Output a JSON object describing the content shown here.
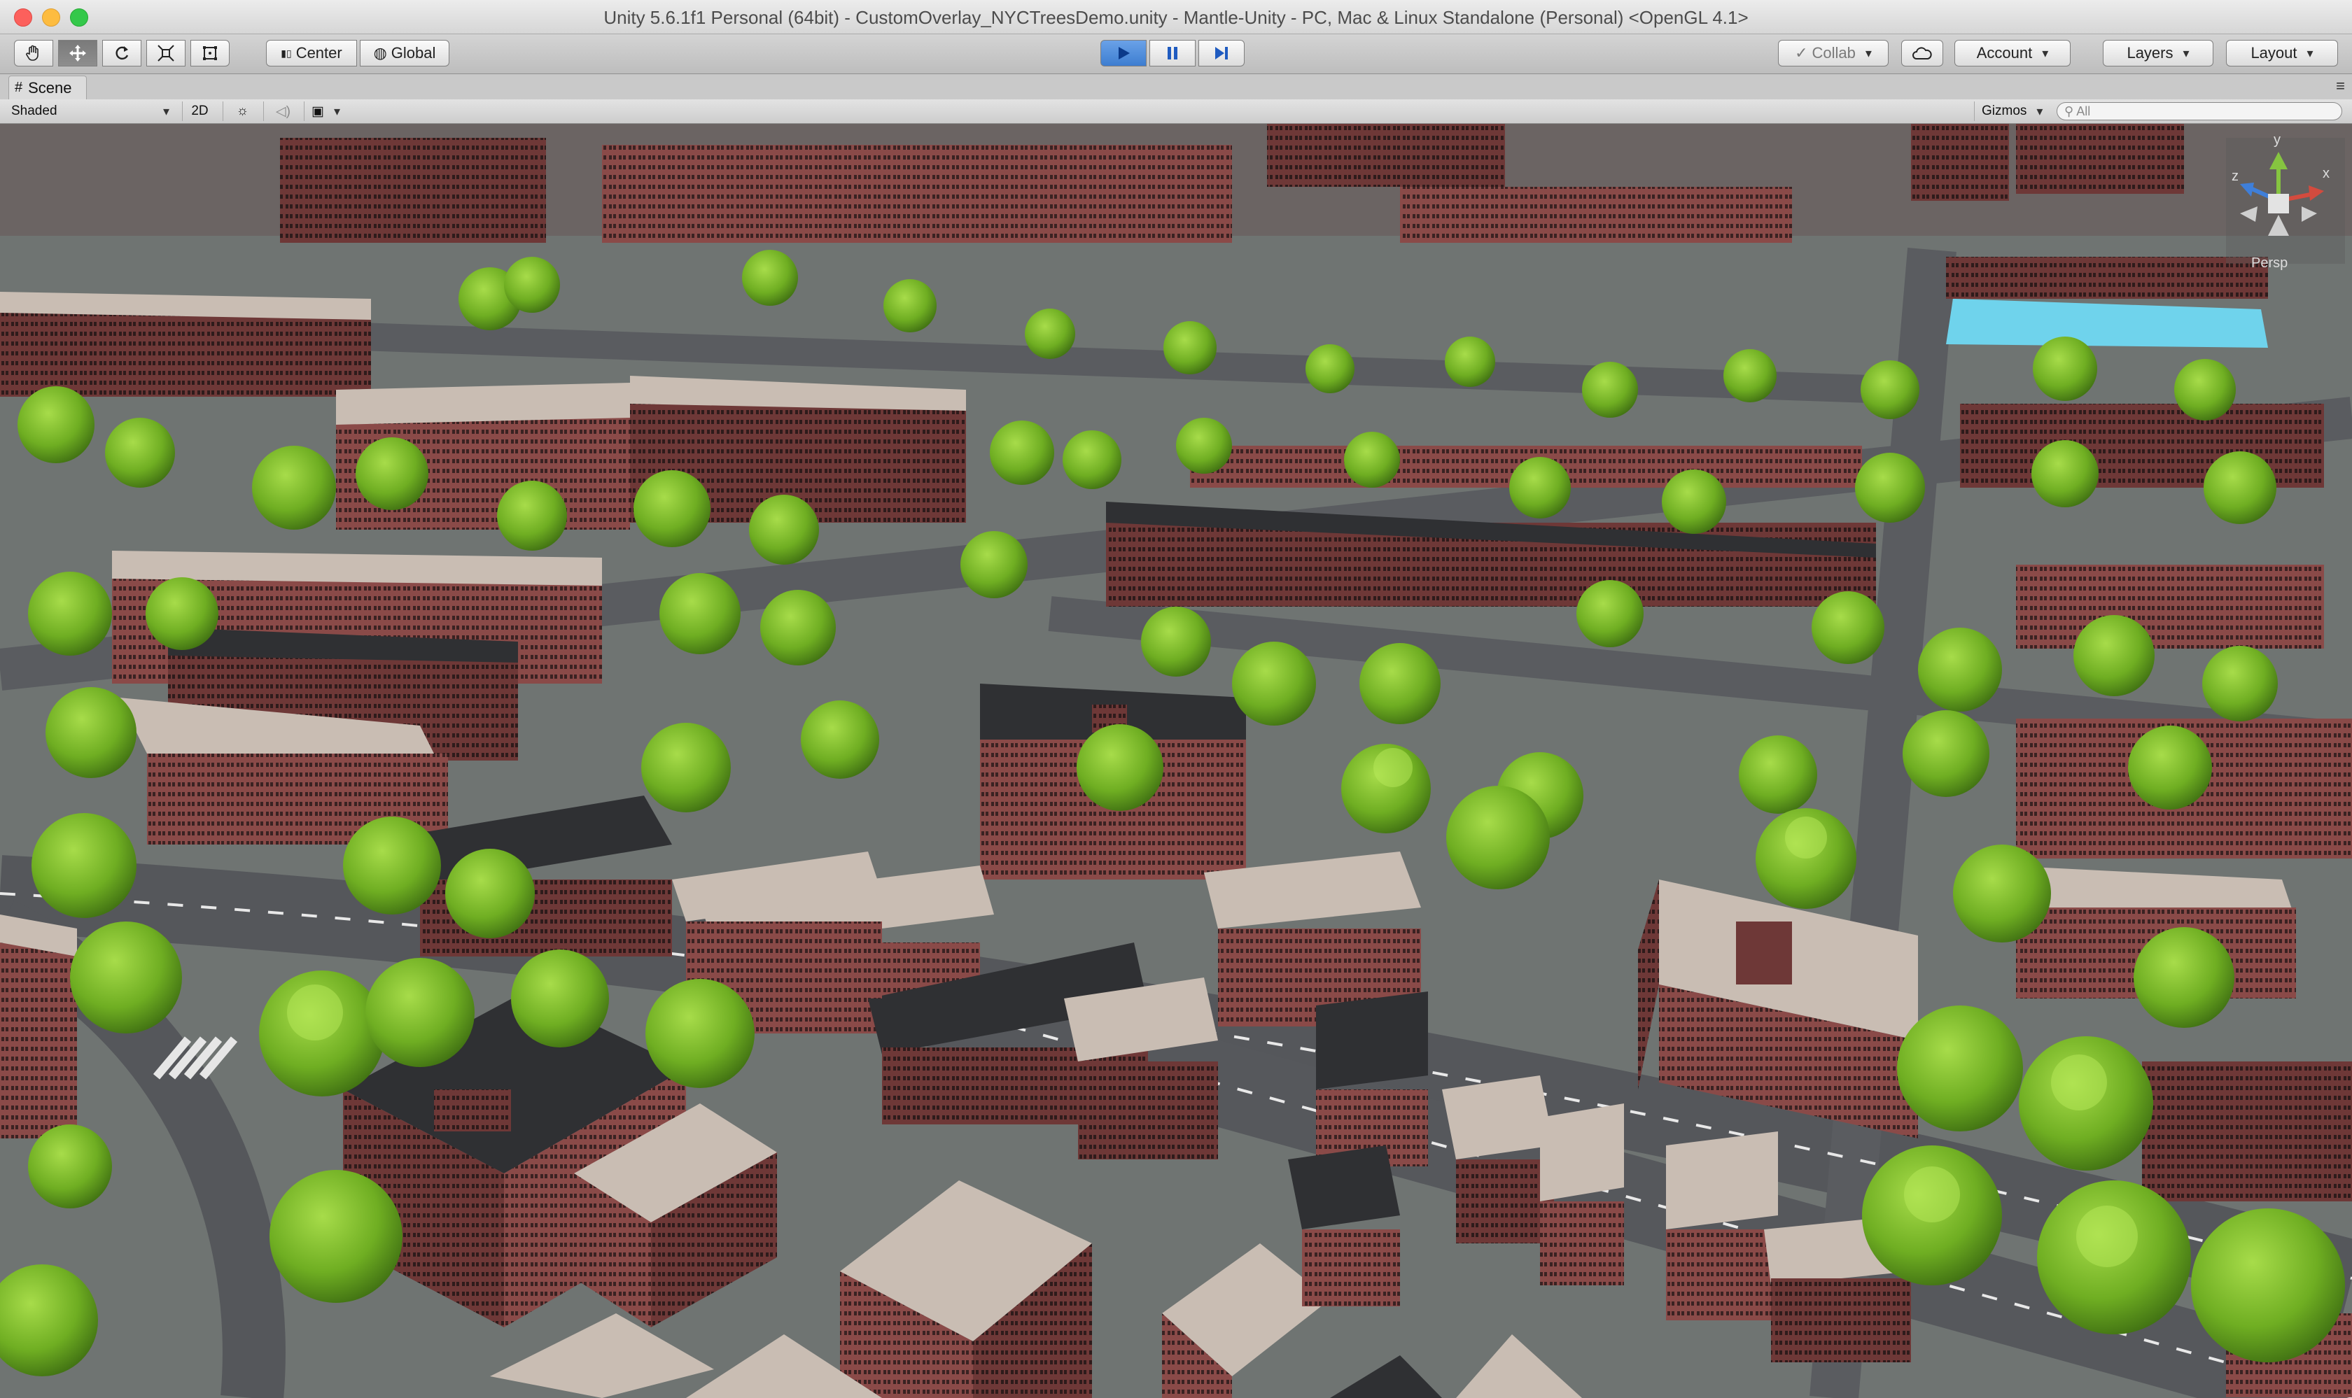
{
  "window": {
    "title": "Unity 5.6.1f1 Personal (64bit) - CustomOverlay_NYCTreesDemo.unity - Mantle-Unity - PC, Mac & Linux Standalone (Personal) <OpenGL 4.1>"
  },
  "toolbar": {
    "tools": [
      {
        "icon": "hand-icon"
      },
      {
        "icon": "move-icon"
      },
      {
        "icon": "rotate-icon"
      },
      {
        "icon": "scale-icon"
      },
      {
        "icon": "rect-tool-icon"
      }
    ],
    "pivot_label": "Center",
    "space_label": "Global",
    "collab_label": "Collab",
    "account_label": "Account",
    "layers_label": "Layers",
    "layout_label": "Layout"
  },
  "tab": {
    "scene_label": "Scene"
  },
  "scene_options": {
    "shading_mode": "Shaded",
    "mode_2d": "2D",
    "gizmos_label": "Gizmos",
    "search_placeholder": "All"
  },
  "scene_view": {
    "gizmo": {
      "y": "y",
      "x": "x",
      "z": "z",
      "projection": "Persp"
    }
  },
  "colors": {
    "play_active": "#3d7dd0",
    "brick": "#8a4a48",
    "roof": "#c9bdb3",
    "dark_roof": "#2f3033",
    "tree": "#79b52a",
    "road": "#585a5d",
    "water": "#6fd3ec"
  }
}
